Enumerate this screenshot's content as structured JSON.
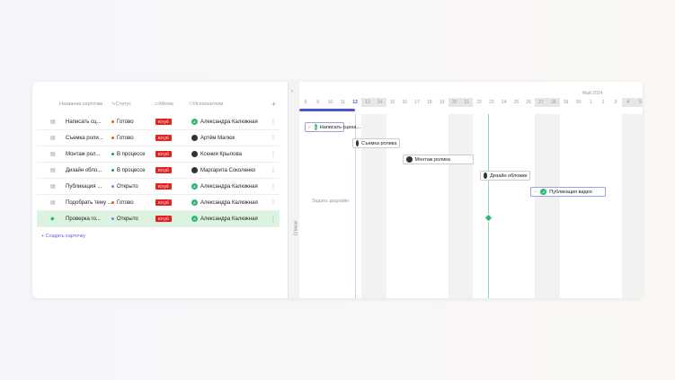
{
  "columns": {
    "name": "Название карточки",
    "status": "Статус",
    "tags": "Метки",
    "assignees": "Исполнители",
    "add": "+"
  },
  "rows": [
    {
      "name": "Написать сц...",
      "status": "Готово",
      "status_color": "#f05a28",
      "tag": "Ютуб",
      "assignee": "Александра Калюжная",
      "avatar": "A"
    },
    {
      "name": "Съемка роли...",
      "status": "Готово",
      "status_color": "#f05a28",
      "tag": "Ютуб",
      "assignee": "Артём Малюк",
      "avatar": ""
    },
    {
      "name": "Монтаж рол...",
      "status": "В процессе",
      "status_color": "#1e9e3a",
      "tag": "Ютуб",
      "assignee": "Ксения Крылова",
      "avatar": ""
    },
    {
      "name": "Дизайн обло...",
      "status": "В процессе",
      "status_color": "#1e9e3a",
      "tag": "Ютуб",
      "assignee": "Маргарита Соколенко",
      "avatar": ""
    },
    {
      "name": "Публикация ...",
      "status": "Открыто",
      "status_color": "#7b86e0",
      "tag": "Ютуб",
      "assignee": "Александра Калюжная",
      "avatar": "A"
    },
    {
      "name": "Подобрать тему ...",
      "status": "Готово",
      "status_color": "#f05a28",
      "tag": "Ютуб",
      "assignee": "Александра Калюжная",
      "avatar": "A"
    },
    {
      "name": "Проверка го...",
      "status": "Открыто",
      "status_color": "#7b86e0",
      "tag": "Ютуб",
      "assignee": "Александра Калюжная",
      "avatar": "A"
    }
  ],
  "create_card": "+ Создать карточку",
  "side_tab": "Список",
  "gantt": {
    "month": "Май 2024",
    "days": [
      "8",
      "9",
      "10",
      "11",
      "12",
      "13",
      "14",
      "15",
      "16",
      "17",
      "18",
      "19",
      "20",
      "21",
      "22",
      "23",
      "24",
      "25",
      "26",
      "27",
      "28",
      "29",
      "30",
      "1",
      "2",
      "3",
      "4",
      "5"
    ],
    "weekends": [
      "13",
      "14",
      "20",
      "21",
      "27",
      "28",
      "4",
      "5"
    ],
    "today": "12",
    "deadline_hint": "Задать дедлайн",
    "bars": [
      {
        "label": "Написать сцена...",
        "avatar": "A"
      },
      {
        "label": "Съемка ролика",
        "avatar": ""
      },
      {
        "label": "Монтаж ролика",
        "avatar": ""
      },
      {
        "label": "Дизайн обложки",
        "avatar": ""
      },
      {
        "label": "Публикация видео",
        "avatar": "A"
      }
    ]
  },
  "colors": {
    "accent": "#4a55d6",
    "green": "#2fb673",
    "tag": "#e52222"
  }
}
